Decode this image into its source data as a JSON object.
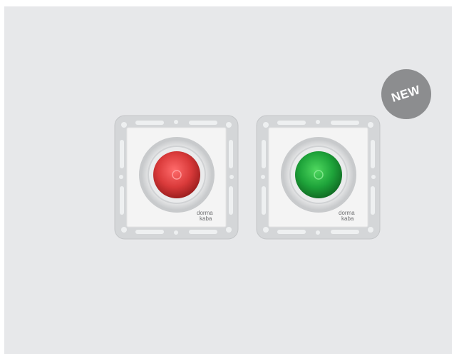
{
  "badge": {
    "text": "NEW",
    "color": "#8c8d8f"
  },
  "devices": [
    {
      "name": "red-button",
      "button_color": "#d93a3a",
      "brand_line1": "dorma",
      "brand_line2": "kaba"
    },
    {
      "name": "green-button",
      "button_color": "#1ea33a",
      "brand_line1": "dorma",
      "brand_line2": "kaba"
    }
  ],
  "colors": {
    "background": "#e7e8ea",
    "frame": "#d4d6d8",
    "plate": "#f4f4f4"
  }
}
